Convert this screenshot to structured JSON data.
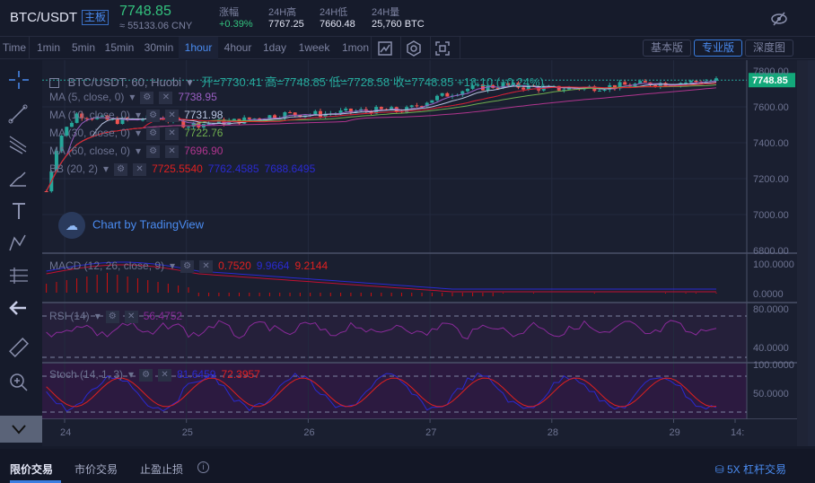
{
  "header": {
    "pair": "BTC/USDT",
    "board": "主板",
    "price": "7748.85",
    "cny": "≈ 55133.06 CNY",
    "stats": [
      {
        "label": "涨幅",
        "value": "+0.39%",
        "color": "#33c27e"
      },
      {
        "label": "24H高",
        "value": "7767.25"
      },
      {
        "label": "24H低",
        "value": "7660.48"
      },
      {
        "label": "24H量",
        "value": "25,760 BTC"
      }
    ],
    "right_icon": "eye-off-icon"
  },
  "toolbar": {
    "timeframes": [
      "Time",
      "1min",
      "5min",
      "15min",
      "30min",
      "1hour",
      "4hour",
      "1day",
      "1week",
      "1mon"
    ],
    "active": "1hour",
    "icons": [
      "indicator-icon",
      "settings-hex-icon",
      "fullscreen-icon"
    ],
    "versions": [
      {
        "label": "基本版",
        "active": false
      },
      {
        "label": "专业版",
        "active": true
      },
      {
        "label": "深度图",
        "active": false
      }
    ]
  },
  "left_tools": [
    "crosshair-icon",
    "trend-line-icon",
    "fib-icon",
    "brush-icon",
    "text-icon",
    "pattern-icon",
    "measure-icon",
    "back-arrow-icon",
    "ruler-icon",
    "zoom-in-icon",
    "scroll-down-icon"
  ],
  "legend": {
    "title": "BTC/USDT, 60, Huobi",
    "ohlc": "开=7730.41  高=7748.85  低=7728.58  收=7748.85  +18.10 (+0.24%)",
    "indicators": [
      {
        "label": "MA (5, close, 0)",
        "values": [
          {
            "v": "7738.95",
            "c": "#9a5fc4"
          }
        ]
      },
      {
        "label": "MA (10, close, 0)",
        "values": [
          {
            "v": "7731.98",
            "c": "#b8c4e0"
          }
        ]
      },
      {
        "label": "MA (30, close, 0)",
        "values": [
          {
            "v": "7722.76",
            "c": "#6fae4f"
          }
        ]
      },
      {
        "label": "MA (60, close, 0)",
        "values": [
          {
            "v": "7696.90",
            "c": "#b0358e"
          }
        ]
      },
      {
        "label": "BB (20, 2)",
        "values": [
          {
            "v": "7725.5540",
            "c": "#e02020"
          },
          {
            "v": "7762.4585",
            "c": "#2a2ad0"
          },
          {
            "v": "7688.6495",
            "c": "#2a2ad0"
          }
        ]
      }
    ],
    "macd": {
      "label": "MACD (12, 26, close, 9)",
      "values": [
        {
          "v": "0.7520",
          "c": "#e02020"
        },
        {
          "v": "9.9664",
          "c": "#2a2ad0"
        },
        {
          "v": "9.2144",
          "c": "#e02020"
        }
      ]
    },
    "rsi": {
      "label": "RSI (14)",
      "values": [
        {
          "v": "56.4752",
          "c": "#8a2a9a"
        }
      ]
    },
    "stoch": {
      "label": "Stoch (14, 1, 3)",
      "values": [
        {
          "v": "81.6459",
          "c": "#2a2ad0"
        },
        {
          "v": "72.3957",
          "c": "#e02020"
        }
      ]
    }
  },
  "watermark": "Chart by TradingView",
  "price_axis": {
    "ticks": [
      "7800.00",
      "7600.00",
      "7400.00",
      "7200.00",
      "7000.00",
      "6800.00"
    ],
    "last": "7748.85",
    "macd_ticks": [
      "100.0000",
      "0.0000"
    ],
    "rsi_ticks": [
      "80.0000",
      "40.0000"
    ],
    "stoch_ticks": [
      "100.0000",
      "50.0000"
    ]
  },
  "time_axis": [
    "24",
    "25",
    "26",
    "27",
    "28",
    "29",
    "14:"
  ],
  "chart_data": {
    "type": "candlestick",
    "up_color": "#26a69a",
    "down_color": "#ef5350",
    "x_unit": "day",
    "ylim": [
      6800,
      7820
    ],
    "price_path": [
      [
        23.85,
        7130
      ],
      [
        23.95,
        7420
      ],
      [
        24.1,
        7560
      ],
      [
        24.4,
        7520
      ],
      [
        24.8,
        7540
      ],
      [
        25.0,
        7500
      ],
      [
        25.4,
        7520
      ],
      [
        25.8,
        7560
      ],
      [
        26.1,
        7560
      ],
      [
        26.5,
        7580
      ],
      [
        26.8,
        7580
      ],
      [
        27.0,
        7640
      ],
      [
        27.3,
        7700
      ],
      [
        27.6,
        7720
      ],
      [
        28.0,
        7700
      ],
      [
        28.4,
        7710
      ],
      [
        28.8,
        7730
      ],
      [
        29.2,
        7740
      ],
      [
        29.37,
        7748.85
      ]
    ]
  },
  "bottom": {
    "tabs": [
      "限价交易",
      "市价交易",
      "止盈止损"
    ],
    "active": "限价交易",
    "info_icon": "info-icon",
    "lever": "5X 杠杆交易",
    "lever_icon": "coins-icon"
  }
}
